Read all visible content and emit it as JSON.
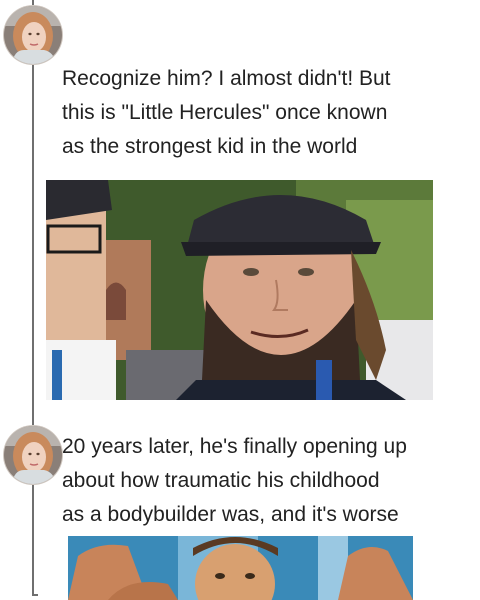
{
  "posts": [
    {
      "avatar_icon": "user-avatar-icon",
      "text": "Recognize him? I almost didn't! But\nthis is \"Little Hercules\" once known\nas the strongest kid in the world",
      "image_icon": "man-in-cap-selfie-photo"
    },
    {
      "avatar_icon": "user-avatar-icon",
      "text": "20 years later, he's finally opening up\nabout how traumatic his childhood\nas a bodybuilder was, and it's worse",
      "image_icon": "child-bodybuilder-flexing-photo"
    }
  ],
  "colors": {
    "thread_line": "#6f6f6f",
    "text": "#222222",
    "background": "#ffffff"
  }
}
